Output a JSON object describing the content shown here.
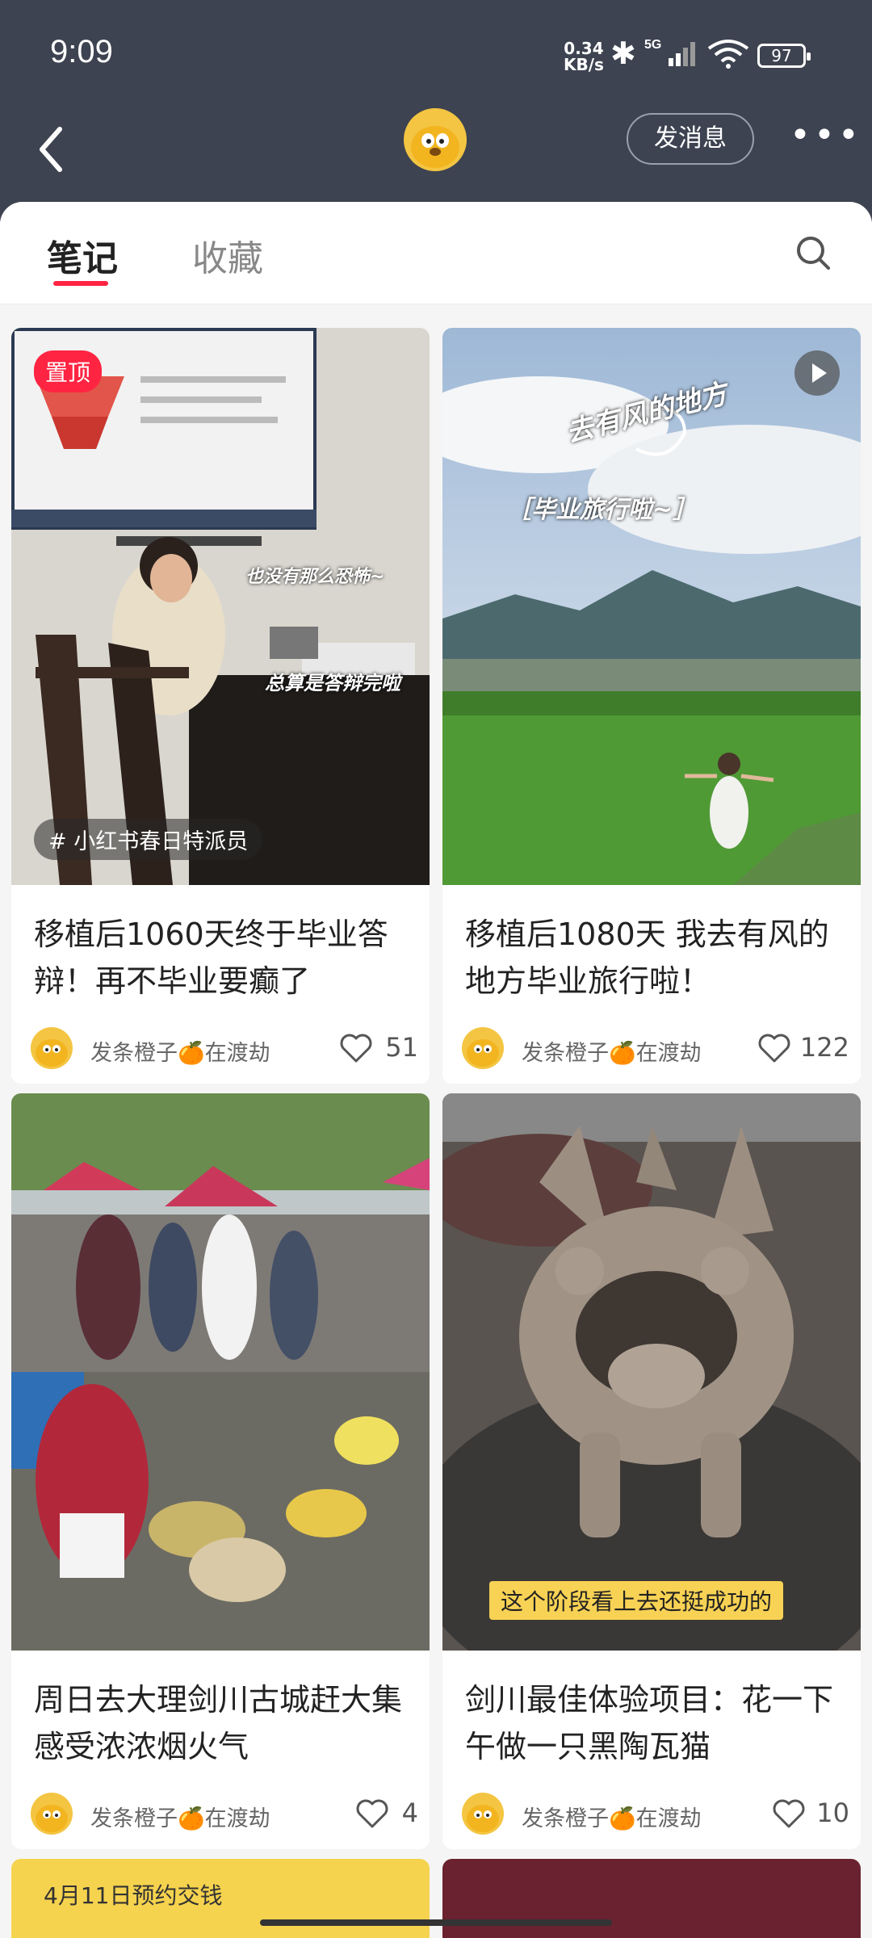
{
  "status_bar": {
    "time": "9:09",
    "net_speed_value": "0.34",
    "net_speed_unit": "KB/s",
    "network": "5G",
    "battery": "97"
  },
  "header": {
    "message_button": "发消息",
    "more": "•••"
  },
  "tabs": [
    {
      "label": "笔记"
    },
    {
      "label": "收藏"
    }
  ],
  "cards": [
    {
      "title": "移植后1060天终于毕业答辩！再不毕业要癫了",
      "author": "发条橙子🍊在渡劫",
      "likes": "51",
      "badge": "置顶",
      "tag": "小红书春日特派员",
      "overlay_1": "也没有那么恐怖~",
      "overlay_2": "总算是答辩完啦"
    },
    {
      "title": "移植后1080天 我去有风的地方毕业旅行啦！",
      "author": "发条橙子🍊在渡劫",
      "likes": "122",
      "overlay_1": "去有风的地方",
      "overlay_2": "［毕业旅行啦~］"
    },
    {
      "title": "周日去大理剑川古城赶大集 感受浓浓烟火气",
      "author": "发条橙子🍊在渡劫",
      "likes": "4"
    },
    {
      "title": "剑川最佳体验项目：花一下午做一只黑陶瓦猫",
      "author": "发条橙子🍊在渡劫",
      "likes": "10",
      "caption": "这个阶段看上去还挺成功的"
    }
  ],
  "next_card": {
    "banner_text": "4月11日预约交钱"
  },
  "colors": {
    "accent": "#ff2442",
    "header_bg": "#3d4350",
    "avatar": "#f4c542"
  }
}
